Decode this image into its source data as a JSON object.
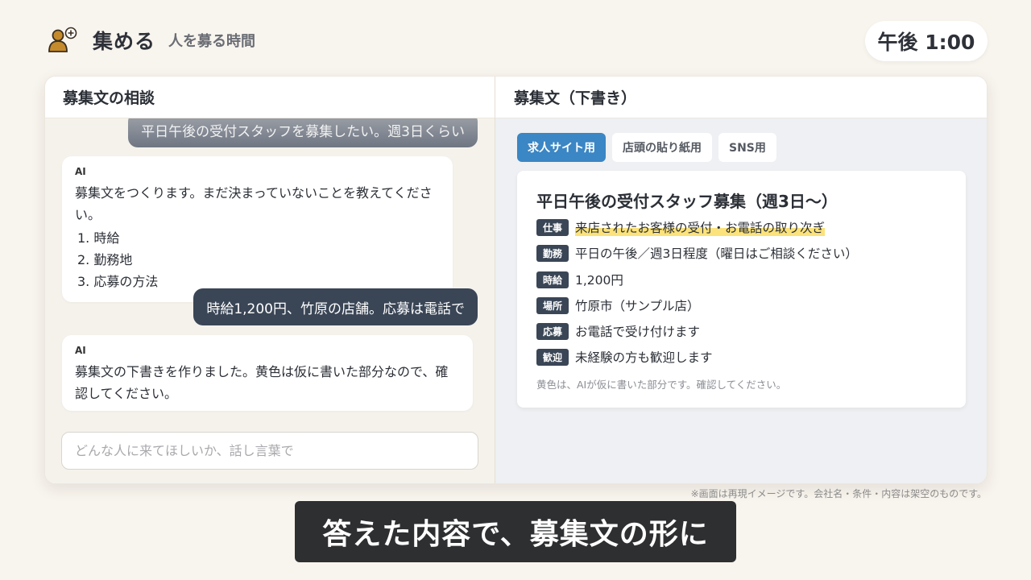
{
  "app": {
    "title": "集める",
    "subtitle": "人を募る時間",
    "clock": "午後 1:00",
    "logo_icon": "person-add-icon"
  },
  "chat": {
    "header": "募集文の相談",
    "messages": [
      {
        "role": "user",
        "text": "平日午後の受付スタッフを募集したい。週3日くらい"
      },
      {
        "role": "ai",
        "label": "AI",
        "text": "募集文をつくります。まだ決まっていないことを教えてください。",
        "list": [
          "1. 時給",
          "2. 勤務地",
          "3. 応募の方法"
        ]
      },
      {
        "role": "user",
        "text": "時給1,200円、竹原の店舗。応募は電話で"
      },
      {
        "role": "ai",
        "label": "AI",
        "text": "募集文の下書きを作りました。黄色は仮に書いた部分なので、確認してください。"
      }
    ],
    "input_placeholder": "どんな人に来てほしいか、話し言葉で"
  },
  "draft": {
    "header": "募集文（下書き）",
    "tabs": [
      {
        "label": "求人サイト用",
        "active": true
      },
      {
        "label": "店頭の貼り紙用",
        "active": false
      },
      {
        "label": "SNS用",
        "active": false
      }
    ],
    "title": "平日午後の受付スタッフ募集（週3日〜）",
    "rows": [
      {
        "tag": "仕事",
        "text": "来店されたお客様の受付・お電話の取り次ぎ",
        "highlight": true
      },
      {
        "tag": "勤務",
        "text": "平日の午後／週3日程度（曜日はご相談ください）",
        "highlight": false
      },
      {
        "tag": "時給",
        "text": "1,200円",
        "highlight": false
      },
      {
        "tag": "場所",
        "text": "竹原市（サンプル店）",
        "highlight": false
      },
      {
        "tag": "応募",
        "text": "お電話で受け付けます",
        "highlight": false
      },
      {
        "tag": "歓迎",
        "text": "未経験の方も歓迎します",
        "highlight": false
      }
    ],
    "note": "黄色は、AIが仮に書いた部分です。確認してください。",
    "highlight_color": "#fbe27a"
  },
  "disclaimer": "※画面は再現イメージです。会社名・条件・内容は架空のものです。",
  "caption": "答えた内容で、募集文の形に"
}
